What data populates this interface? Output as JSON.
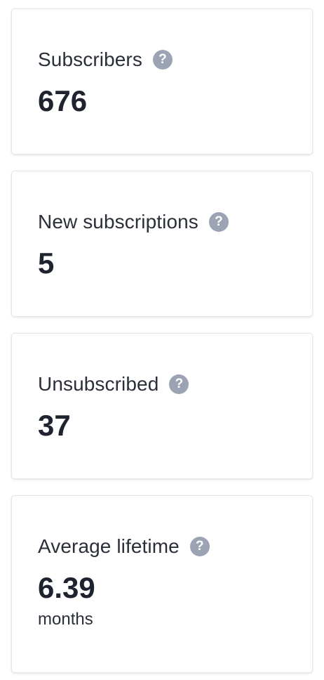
{
  "stats": {
    "subscribers": {
      "label": "Subscribers",
      "value": "676",
      "help_icon": "question-circle-icon"
    },
    "new_subscriptions": {
      "label": "New subscriptions",
      "value": "5",
      "help_icon": "question-circle-icon"
    },
    "unsubscribed": {
      "label": "Unsubscribed",
      "value": "37",
      "help_icon": "question-circle-icon"
    },
    "average_lifetime": {
      "label": "Average lifetime",
      "value": "6.39",
      "unit": "months",
      "help_icon": "question-circle-icon"
    }
  },
  "colors": {
    "text": "#1f2330",
    "help_icon_bg": "#9ca3b3",
    "card_border": "#e3e5e9"
  }
}
